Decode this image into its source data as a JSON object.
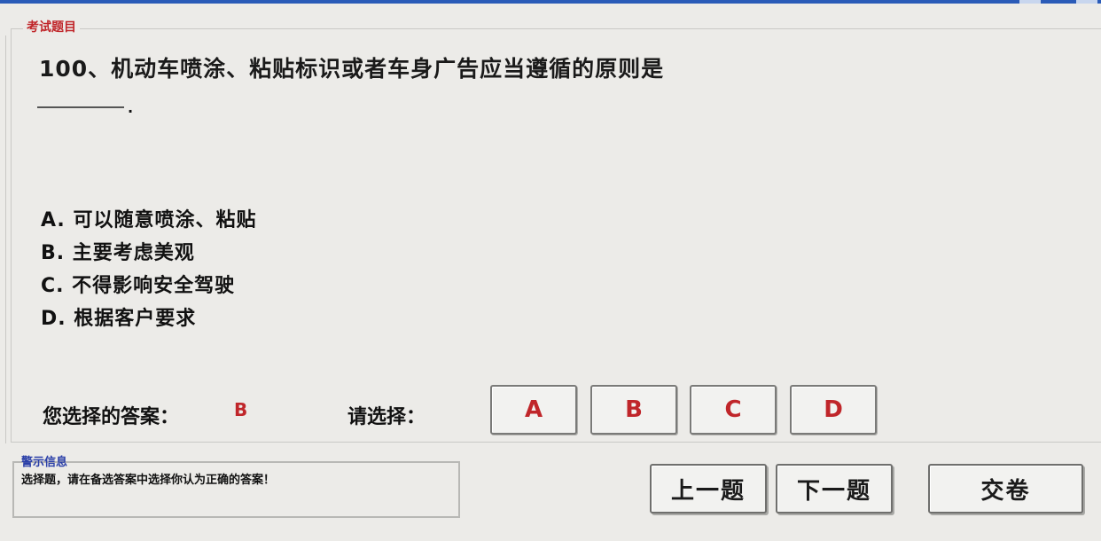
{
  "question_group": {
    "caption": "考试题目",
    "question": "100、机动车喷涂、粘贴标识或者车身广告应当遵循的原则是",
    "blank_suffix": "."
  },
  "options": [
    {
      "label": "A. 可以随意喷涂、粘贴"
    },
    {
      "label": "B. 主要考虑美观"
    },
    {
      "label": "C. 不得影响安全驾驶"
    },
    {
      "label": "D. 根据客户要求"
    }
  ],
  "answer": {
    "label": "您选择的答案：",
    "value": "B"
  },
  "select": {
    "label": "请选择：",
    "choices": [
      "A",
      "B",
      "C",
      "D"
    ]
  },
  "hint": {
    "caption": "警示信息",
    "text": "选择题，请在备选答案中选择你认为正确的答案！"
  },
  "nav": {
    "prev": "上一题",
    "next": "下一题",
    "submit": "交卷"
  },
  "colors": {
    "accent_red": "#c0262a",
    "caption_blue": "#2a3fa8",
    "background": "#ecebe8"
  }
}
